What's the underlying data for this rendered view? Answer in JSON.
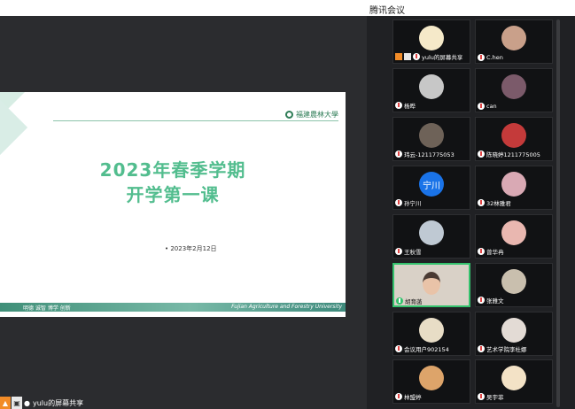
{
  "window": {
    "title": "腾讯会议"
  },
  "slide": {
    "title_line1": "2023年春季学期",
    "title_line2": "开学第一课",
    "date": "• 2023年2月12日",
    "logo_text": "福建農林大學",
    "footer_motto": "明德 诚智 博学 创新",
    "footer_university": "Fujian Agriculture and Forestry University"
  },
  "share": {
    "label": "yulu的屏幕共享"
  },
  "icons": {
    "sharing": "screen-share-icon",
    "camera": "camera-icon",
    "mic": "mic-icon"
  },
  "colors": {
    "accent_green": "#52bd8e",
    "speaking_border": "#34c26d",
    "share_orange": "#f28c28",
    "panel_bg": "#202124"
  },
  "participants": [
    {
      "name": "yulu的屏幕共享",
      "avatar_bg": "#f5e9c9",
      "avatar_text": ""
    },
    {
      "name": "C.hen",
      "avatar_bg": "#c9a08a",
      "avatar_text": ""
    },
    {
      "name": "杨晔",
      "avatar_bg": "#c7c7c7",
      "avatar_text": ""
    },
    {
      "name": "can",
      "avatar_bg": "#7b5a6a",
      "avatar_text": ""
    },
    {
      "name": "玮云-1211775053",
      "avatar_bg": "#6e6258",
      "avatar_text": ""
    },
    {
      "name": "陈晓婷1211775005",
      "avatar_bg": "#c43a3a",
      "avatar_text": ""
    },
    {
      "name": "孙宁川",
      "avatar_bg": "#1a73e8",
      "avatar_text": "宁川"
    },
    {
      "name": "32林雅君",
      "avatar_bg": "#d9a9b4",
      "avatar_text": ""
    },
    {
      "name": "王秋雪",
      "avatar_bg": "#bfc9d3",
      "avatar_text": ""
    },
    {
      "name": "曾华冉",
      "avatar_bg": "#e9b7b0",
      "avatar_text": ""
    },
    {
      "name": "胡育菡",
      "avatar_bg": "#d9d1c7",
      "avatar_text": ""
    },
    {
      "name": "张雅文",
      "avatar_bg": "#c9bfae",
      "avatar_text": ""
    },
    {
      "name": "会议用户902154",
      "avatar_bg": "#e8ddc6",
      "avatar_text": ""
    },
    {
      "name": "艺术学院李杜娜",
      "avatar_bg": "#e3dbd5",
      "avatar_text": ""
    },
    {
      "name": "林盟婷",
      "avatar_bg": "#dda46a",
      "avatar_text": ""
    },
    {
      "name": "吴宇菲",
      "avatar_bg": "#f3e2c6",
      "avatar_text": ""
    }
  ]
}
